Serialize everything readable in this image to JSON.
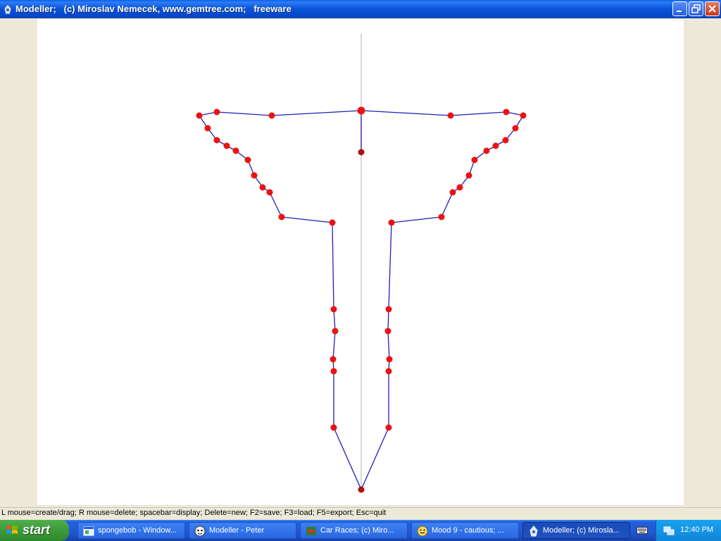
{
  "window": {
    "title": "Modeller;   (c) Miroslav Nemecek, www.gemtree.com;   freeware"
  },
  "status_bar": {
    "text": "L mouse=create/drag; R mouse=delete; spacebar=display; Delete=new; F2=save; F3=load; F5=export; Esc=quit"
  },
  "model": {
    "colors": {
      "outline": "#1f1fb5",
      "vertex": "#ee1111",
      "axis_vertex": "#b01010",
      "axis": "#c8c8c8",
      "background": "#ffffff"
    },
    "vertices": [
      [
        513,
        157
      ],
      [
        386,
        164
      ],
      [
        308,
        159
      ],
      [
        283,
        164
      ],
      [
        295,
        182
      ],
      [
        308,
        199
      ],
      [
        322,
        207
      ],
      [
        335,
        214
      ],
      [
        352,
        227
      ],
      [
        361,
        249
      ],
      [
        373,
        266
      ],
      [
        383,
        273
      ],
      [
        400,
        308
      ],
      [
        472,
        316
      ],
      [
        474,
        439
      ],
      [
        476,
        470
      ],
      [
        473,
        510
      ],
      [
        474,
        527
      ],
      [
        474,
        607
      ],
      [
        513,
        695
      ],
      [
        552,
        607
      ],
      [
        552,
        527
      ],
      [
        553,
        510
      ],
      [
        551,
        470
      ],
      [
        552,
        439
      ],
      [
        556,
        316
      ],
      [
        627,
        308
      ],
      [
        643,
        273
      ],
      [
        653,
        266
      ],
      [
        666,
        249
      ],
      [
        674,
        227
      ],
      [
        691,
        214
      ],
      [
        704,
        207
      ],
      [
        718,
        199
      ],
      [
        732,
        182
      ],
      [
        743,
        164
      ],
      [
        719,
        159
      ],
      [
        640,
        164
      ]
    ],
    "extra_vertices": [
      [
        513,
        216
      ]
    ],
    "extra_edges": [
      [
        [
          513,
          157
        ],
        [
          513,
          216
        ]
      ]
    ]
  },
  "taskbar": {
    "start_label": "start",
    "tasks": [
      {
        "label": "spongebob - Window...",
        "icon": "window-icon",
        "active": false
      },
      {
        "label": "Modeller - Peter",
        "icon": "peter-icon",
        "active": false
      },
      {
        "label": "Car Races;  (c) Miro...",
        "icon": "car-icon",
        "active": false
      },
      {
        "label": "Mood 9 - cautious;  ...",
        "icon": "smiley-icon",
        "active": false
      },
      {
        "label": "Modeller;  (c) Mirosla...",
        "icon": "modeller-icon",
        "active": true
      }
    ],
    "clock": "12:40 PM"
  }
}
